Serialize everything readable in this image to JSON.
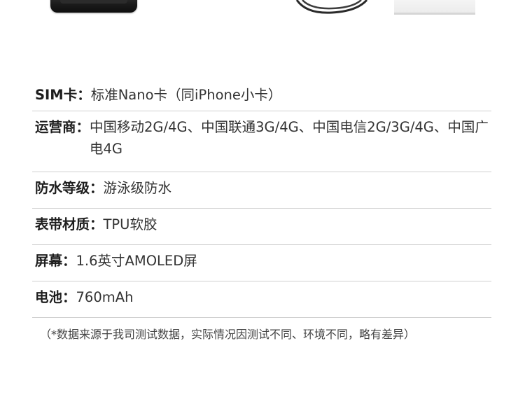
{
  "specs": [
    {
      "label": "SIM卡：",
      "value": "标准Nano卡（同iPhone小卡）"
    },
    {
      "label": "运营商：",
      "value": "中国移动2G/4G、中国联通3G/4G、中国电信2G/3G/4G、中国广电4G"
    },
    {
      "label": "防水等级：",
      "value": "游泳级防水"
    },
    {
      "label": "表带材质：",
      "value": "TPU软胶"
    },
    {
      "label": "屏幕：",
      "value": "1.6英寸AMOLED屏"
    },
    {
      "label": "电池：",
      "value": "760mAh"
    }
  ],
  "footnote": "（*数据来源于我司测试数据，实际情况因测试不同、环境不同，略有差异）"
}
